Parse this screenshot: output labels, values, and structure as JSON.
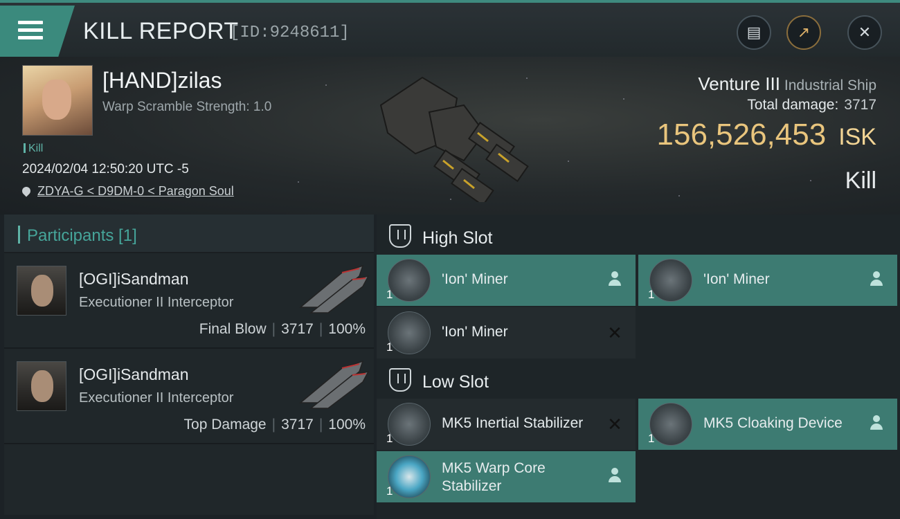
{
  "header": {
    "title": "KILL REPORT",
    "report_id": "[ID:9248611]"
  },
  "victim": {
    "name": "[HAND]zilas",
    "warp_scramble": "Warp Scramble Strength: 1.0",
    "tag": "Kill",
    "datetime": "2024/02/04 12:50:20 UTC -5",
    "location": "ZDYA-G < D9DM-0 < Paragon Soul",
    "ship_name": "Venture III",
    "ship_class": "Industrial Ship",
    "total_damage_label": "Total damage:",
    "total_damage": "3717",
    "isk_value": "156,526,453",
    "isk_unit": "ISK",
    "result": "Kill"
  },
  "participants": {
    "title": "Participants [1]",
    "rows": [
      {
        "name": "[OGI]iSandman",
        "ship": "Executioner II Interceptor",
        "role": "Final Blow",
        "damage": "3717",
        "percent": "100%"
      },
      {
        "name": "[OGI]iSandman",
        "ship": "Executioner II Interceptor",
        "role": "Top Damage",
        "damage": "3717",
        "percent": "100%"
      }
    ]
  },
  "slots": {
    "high": {
      "title": "High Slot",
      "modules": [
        {
          "name": "'Ion' Miner",
          "qty": "1",
          "status": "survived"
        },
        {
          "name": "'Ion' Miner",
          "qty": "1",
          "status": "survived"
        },
        {
          "name": "'Ion' Miner",
          "qty": "1",
          "status": "destroyed"
        }
      ]
    },
    "low": {
      "title": "Low Slot",
      "modules": [
        {
          "name": "MK5 Inertial Stabilizer",
          "qty": "1",
          "status": "destroyed"
        },
        {
          "name": "MK5 Cloaking Device",
          "qty": "1",
          "status": "survived"
        },
        {
          "name": "MK5 Warp Core Stabilizer",
          "qty": "1",
          "status": "survived"
        }
      ]
    }
  },
  "colors": {
    "accent": "#3b8a7d",
    "survived": "#3d7b72",
    "isk": "#e9c57d"
  }
}
